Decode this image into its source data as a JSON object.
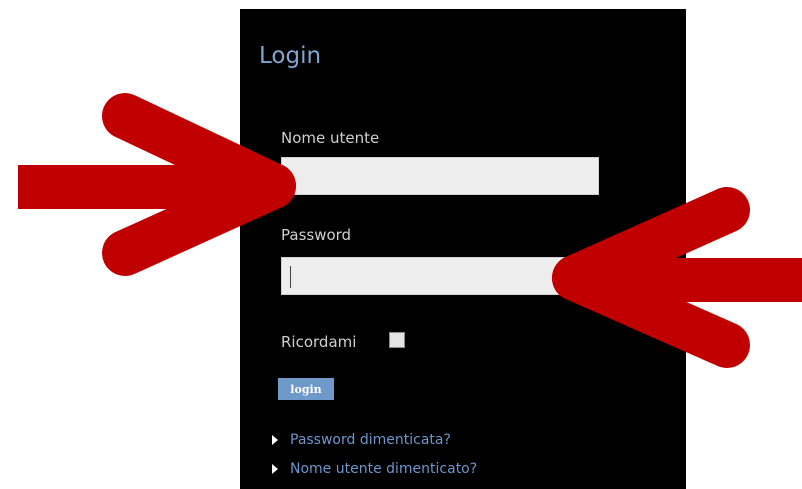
{
  "login": {
    "title": "Login",
    "username_label": "Nome utente",
    "username_value": "",
    "password_label": "Password",
    "password_value": "",
    "remember_label": "Ricordami",
    "remember_checked": false,
    "login_button": "login",
    "links": [
      {
        "label": "Password dimenticata?",
        "icon": "bullet-arrow-icon"
      },
      {
        "label": "Nome utente dimenticato?",
        "icon": "bullet-arrow-icon"
      }
    ]
  },
  "annotations": {
    "arrow_color": "#c00000"
  },
  "colors": {
    "panel_bg": "#000000",
    "title": "#7fa6d2",
    "link": "#6d96cc",
    "button_bg": "#6f99c9",
    "field_bg": "#ededed"
  }
}
